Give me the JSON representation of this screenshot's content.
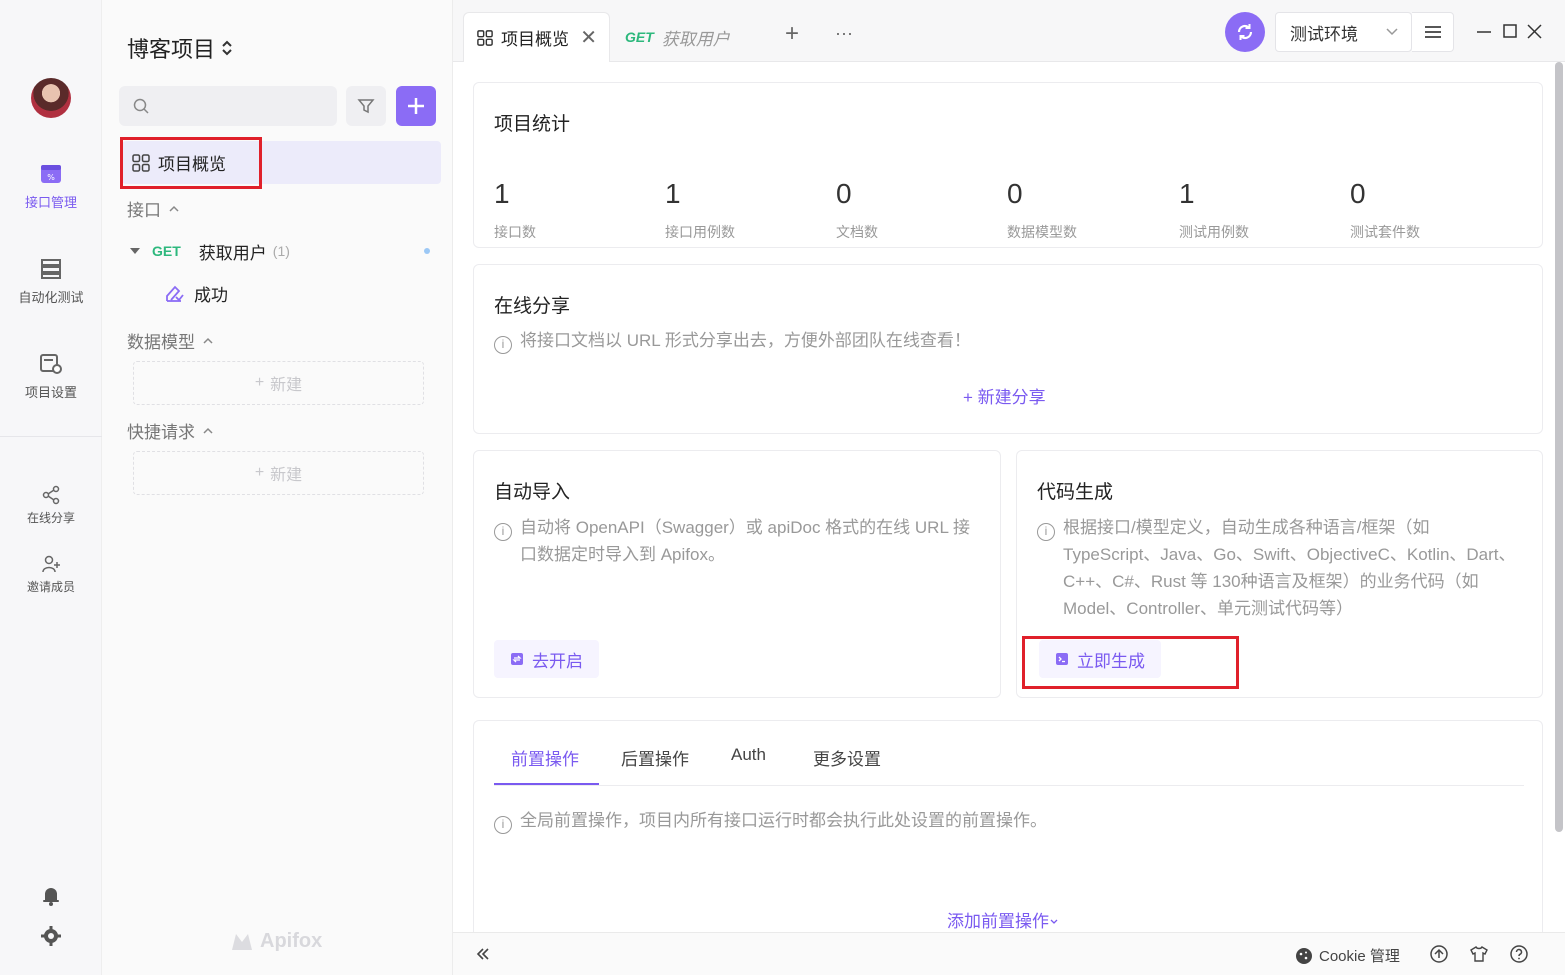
{
  "rail": {
    "items": [
      {
        "label": "接口管理",
        "icon": "api-management-icon",
        "active": true
      },
      {
        "label": "自动化测试",
        "icon": "automation-test-icon"
      },
      {
        "label": "项目设置",
        "icon": "project-settings-icon"
      }
    ],
    "share_label": "在线分享",
    "invite_label": "邀请成员"
  },
  "sidebar": {
    "project_title": "博客项目",
    "search_placeholder": "",
    "overview_label": "项目概览",
    "section_api": "接口",
    "api_method": "GET",
    "api_name": "获取用户",
    "api_count": "(1)",
    "case_name": "成功",
    "section_models": "数据模型",
    "section_quick": "快捷请求",
    "new_label": "新建",
    "brand": "Apifox"
  },
  "topbar": {
    "tabs": [
      {
        "label": "项目概览",
        "active": true
      },
      {
        "method": "GET",
        "label": "获取用户"
      }
    ],
    "add_tab": "+",
    "more": "···",
    "env": "测试环境"
  },
  "stats": {
    "title": "项目统计",
    "items": [
      {
        "num": "1",
        "label": "接口数"
      },
      {
        "num": "1",
        "label": "接口用例数"
      },
      {
        "num": "0",
        "label": "文档数"
      },
      {
        "num": "0",
        "label": "数据模型数"
      },
      {
        "num": "1",
        "label": "测试用例数"
      },
      {
        "num": "0",
        "label": "测试套件数"
      }
    ]
  },
  "share": {
    "title": "在线分享",
    "desc": "将接口文档以 URL 形式分享出去，方便外部团队在线查看！",
    "new_share": "新建分享"
  },
  "auto_import": {
    "title": "自动导入",
    "desc": "自动将 OpenAPI（Swagger）或 apiDoc 格式的在线 URL 接口数据定时导入到 Apifox。",
    "button": "去开启"
  },
  "codegen": {
    "title": "代码生成",
    "desc": "根据接口/模型定义，自动生成各种语言/框架（如 TypeScript、Java、Go、Swift、ObjectiveC、Kotlin、Dart、C++、C#、Rust 等 130种语言及框架）的业务代码（如 Model、Controller、单元测试代码等）",
    "button": "立即生成"
  },
  "ops": {
    "tabs": [
      "前置操作",
      "后置操作",
      "Auth",
      "更多设置"
    ],
    "desc": "全局前置操作，项目内所有接口运行时都会执行此处设置的前置操作。",
    "add": "添加前置操作"
  },
  "statusbar": {
    "cookie": "Cookie 管理"
  },
  "colors": {
    "accent": "#8b6cf5",
    "get_method": "#2db87d",
    "highlight": "#e0202a"
  }
}
